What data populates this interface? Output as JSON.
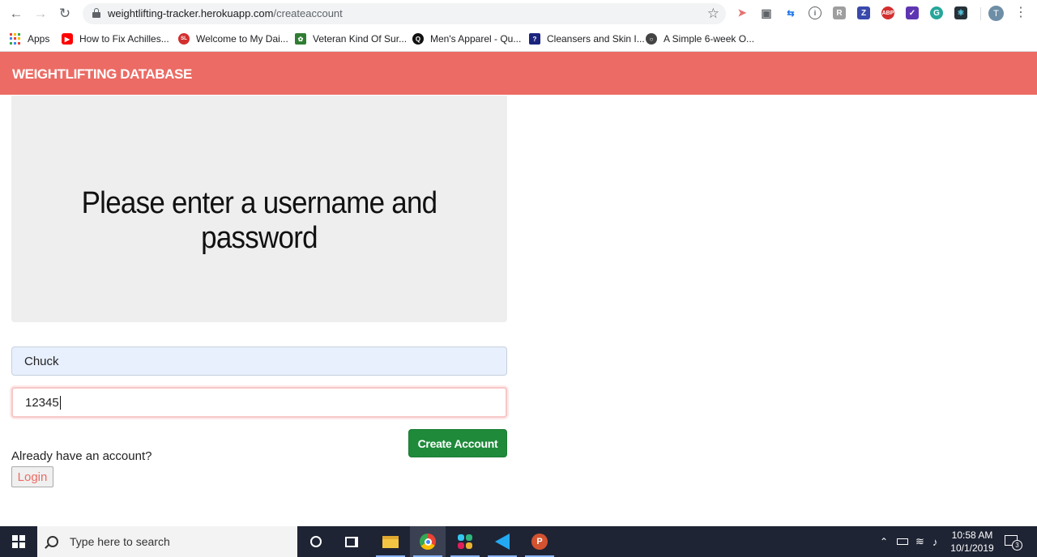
{
  "browser": {
    "url_host": "weightlifting-tracker.herokuapp.com",
    "url_path": "/createaccount",
    "profile_initial": "T",
    "bookmarks": [
      {
        "label": "Apps"
      },
      {
        "label": "How to Fix Achilles..."
      },
      {
        "label": "Welcome to My Dai..."
      },
      {
        "label": "Veteran Kind Of Sur..."
      },
      {
        "label": "Men's Apparel - Qu..."
      },
      {
        "label": "Cleansers and Skin I..."
      },
      {
        "label": "A Simple 6-week O..."
      }
    ]
  },
  "app": {
    "brand": "WEIGHTLIFTING DATABASE",
    "heading": "Please enter a username and password",
    "username_value": "Chuck",
    "password_value": "12345",
    "create_button": "Create Account",
    "already_text": "Already have an account?",
    "login_button": "Login"
  },
  "taskbar": {
    "search_placeholder": "Type here to search",
    "time": "10:58 AM",
    "date": "10/1/2019",
    "notification_count": "3"
  },
  "colors": {
    "header": "#ec6b64",
    "create_button": "#1e8a3a",
    "jumbotron": "#eeeeee"
  }
}
